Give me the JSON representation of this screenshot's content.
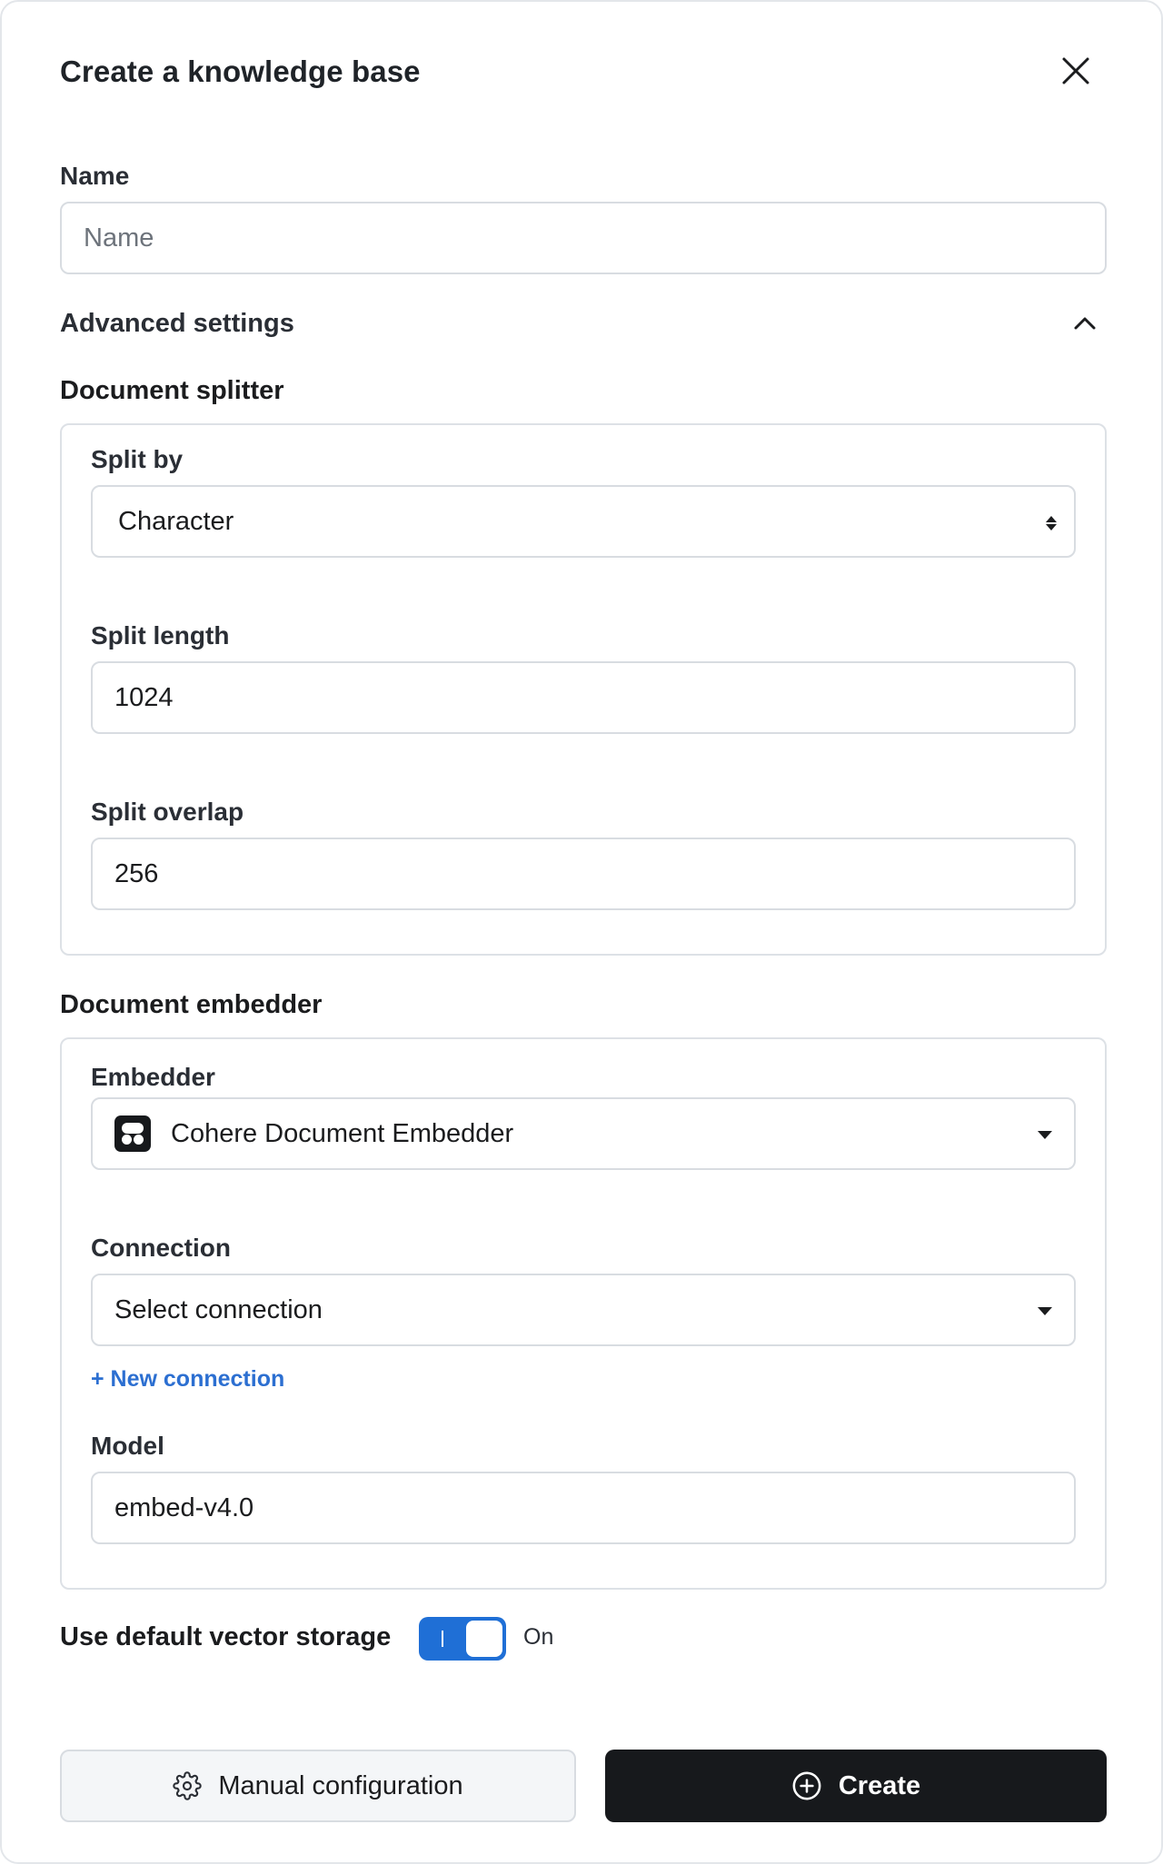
{
  "modal": {
    "title": "Create a knowledge base",
    "close_icon": "close-icon"
  },
  "name_field": {
    "label": "Name",
    "placeholder": "Name",
    "value": ""
  },
  "advanced": {
    "label": "Advanced settings",
    "expanded": true,
    "icon": "chevron-up-icon"
  },
  "splitter": {
    "section_title": "Document splitter",
    "split_by": {
      "label": "Split by",
      "value": "Character"
    },
    "split_length": {
      "label": "Split length",
      "value": "1024"
    },
    "split_overlap": {
      "label": "Split overlap",
      "value": "256"
    }
  },
  "embedder": {
    "section_title": "Document embedder",
    "embedder_field": {
      "label": "Embedder",
      "value": "Cohere Document Embedder",
      "icon": "cohere-logo-icon"
    },
    "connection_field": {
      "label": "Connection",
      "value": "Select connection"
    },
    "new_connection_link": "+ New connection",
    "model_field": {
      "label": "Model",
      "value": "embed-v4.0"
    }
  },
  "vector_storage": {
    "label": "Use default vector storage",
    "state_text": "On",
    "enabled": true
  },
  "actions": {
    "manual_config_label": "Manual configuration",
    "manual_config_icon": "gear-icon",
    "create_label": "Create",
    "create_icon": "plus-circle-icon"
  },
  "colors": {
    "accent": "#1f6fd6",
    "link": "#2c6fd1",
    "primary_button": "#17191c"
  }
}
